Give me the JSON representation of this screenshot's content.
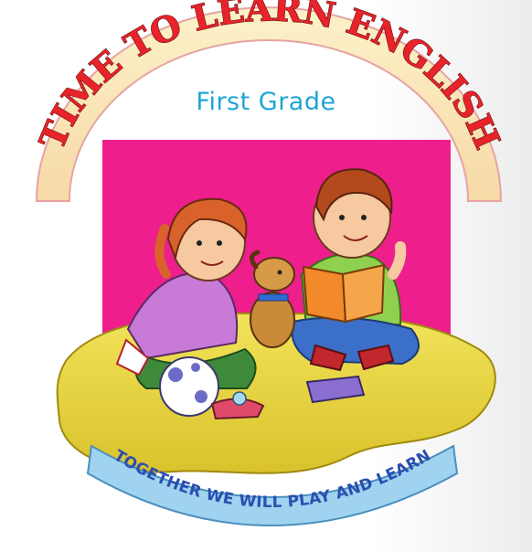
{
  "cover": {
    "title": "TIME TO LEARN ENGLISH",
    "subtitle": "First Grade",
    "motto": "TOGETHER WE WILL PLAY AND LEARN"
  },
  "colors": {
    "title_red": "#e8232a",
    "subtitle_blue": "#1fa6d6",
    "backdrop_magenta": "#ee1e8c",
    "floor_yellow": "#e6d33c",
    "ribbon_blue": "#9fd3ef"
  },
  "illustration": {
    "girl": "girl-figure",
    "boy": "boy-figure",
    "dog": "dog-figure",
    "ball": "ball-icon",
    "toy_plane": "toy-plane-icon",
    "book_open": "open-book-icon",
    "book_closed": "closed-book-icon"
  }
}
